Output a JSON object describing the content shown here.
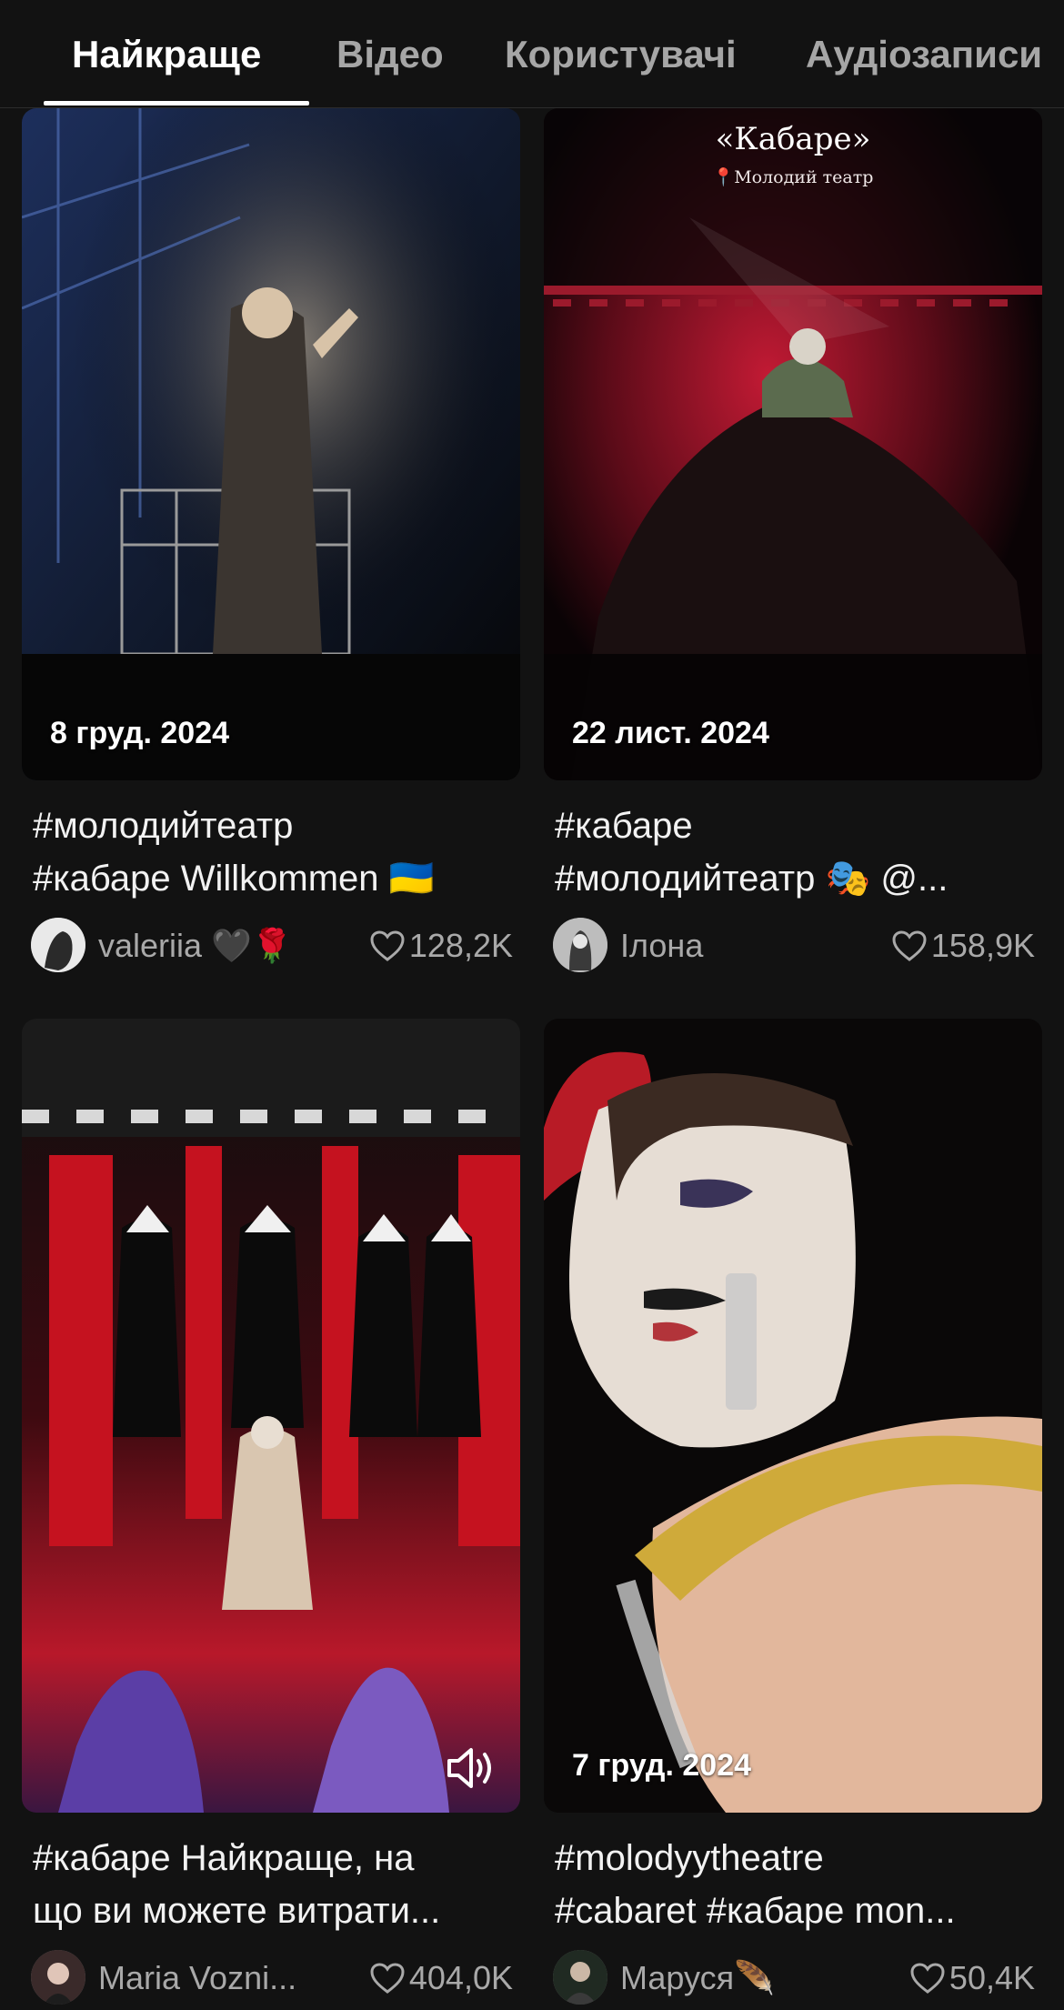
{
  "tabs": [
    {
      "label": "Найкраще",
      "active": true
    },
    {
      "label": "Відео",
      "active": false
    },
    {
      "label": "Користувачі",
      "active": false
    },
    {
      "label": "Аудіозаписи",
      "active": false
    }
  ],
  "posts": [
    {
      "date": "8 груд. 2024",
      "caption_line1": "#молодийтеатр",
      "caption_line2": "#кабаре Willkommen 🇺🇦",
      "username": "valeriia 🖤🌹",
      "likes": "128,2K"
    },
    {
      "date": "22 лист. 2024",
      "overlay_title": "«Кабаре»",
      "overlay_subtitle": "📍Молодий театр",
      "caption_line1": "#кабаре",
      "caption_line2": "#молодийтеатр 🎭 @...",
      "username": "Ілона",
      "likes": "158,9K"
    },
    {
      "caption_line1": "#кабаре Найкраще, на",
      "caption_line2": "що ви можете витрати...",
      "username": "Maria Vozni...",
      "likes": "404,0K",
      "sound_icon": "speaker-on-icon"
    },
    {
      "date": "7 груд. 2024",
      "caption_line1": "#molodyytheatre",
      "caption_line2": "#cabaret #кабаре mon...",
      "username": "Маруся🪶",
      "likes": "50,4K"
    }
  ],
  "colors": {
    "background": "#121212",
    "text_primary": "#ffffff",
    "text_secondary": "#a9a9a9"
  }
}
